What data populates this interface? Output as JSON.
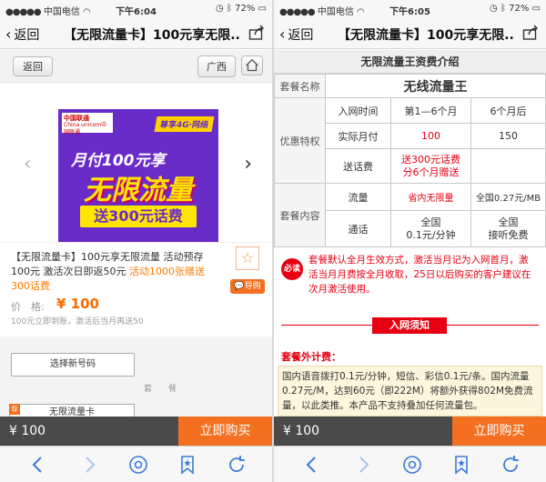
{
  "left": {
    "status": {
      "carrier": "中国电信",
      "time": "下午6:04",
      "battery": "72%"
    },
    "nav": {
      "back": "返回",
      "title": "【无限流量卡】100元享无限..."
    },
    "subhead": {
      "back": "返回",
      "region": "广西"
    },
    "banner": {
      "logo_cn": "中国联通",
      "logo_en": "China unicom中国联通",
      "badge": "尊享4G·网络",
      "line1": "月付100元享",
      "line2": "无限流量",
      "line3": "送300元话费"
    },
    "product": {
      "name_main": "【无限流量卡】100元享无限流量 活动预存100元 激活次日即返50元 ",
      "name_promo": "活动1000张赠送300话费",
      "guide": "导购",
      "price_label": "价　格:",
      "price": "¥ 100",
      "note": "100元立即到账，激活后当月再送50"
    },
    "select_btn": "选择新号码",
    "taocan_label": "套　　餐",
    "package_card": "无限流量卡",
    "hot_tag": "荐",
    "buybar": {
      "price": "¥ 100",
      "buy": "立即购买"
    }
  },
  "right": {
    "status": {
      "carrier": "中国电信",
      "time": "下午6:05",
      "battery": "72%"
    },
    "nav": {
      "back": "返回",
      "title": "【无限流量卡】100元享无限..."
    },
    "intro_title": "无限流量王资费介绍",
    "table": {
      "pkg_name_label": "套餐名称",
      "pkg_name": "无线流量王",
      "offer_label": "优惠特权",
      "h_time": "入网时间",
      "h_m1": "第1—6个月",
      "h_m2": "6个月后",
      "r_pay": "实际月付",
      "pay1": "100",
      "pay2": "150",
      "r_gift": "送话费",
      "gift": "送300元话费\n分6个月赠送",
      "content_label": "套餐内容",
      "r_flow": "流量",
      "flow1": "省内无限量",
      "flow2": "全国0.27元/MB",
      "r_call": "通话",
      "call1": "全国\n0.1元/分钟",
      "call2": "全国\n接听免费"
    },
    "must_read": "必读",
    "must_text": "套餐默认全月生效方式，激活当月记为入网首月，激活当月月费按全月收取，25日以后购买的客户建议在次月激活使用。",
    "notice_title": "入网须知",
    "extra_label": "套餐外计费：",
    "extra_text": "国内语音拨打0.1元/分钟，短信、彩信0.1元/条。国内流量0.27元/M，达到60元（即222M）将额外获得802M免费流量，以此类推。本产品不支持叠加任何流量包。",
    "buybar": {
      "price": "¥ 100",
      "buy": "立即购买"
    }
  }
}
